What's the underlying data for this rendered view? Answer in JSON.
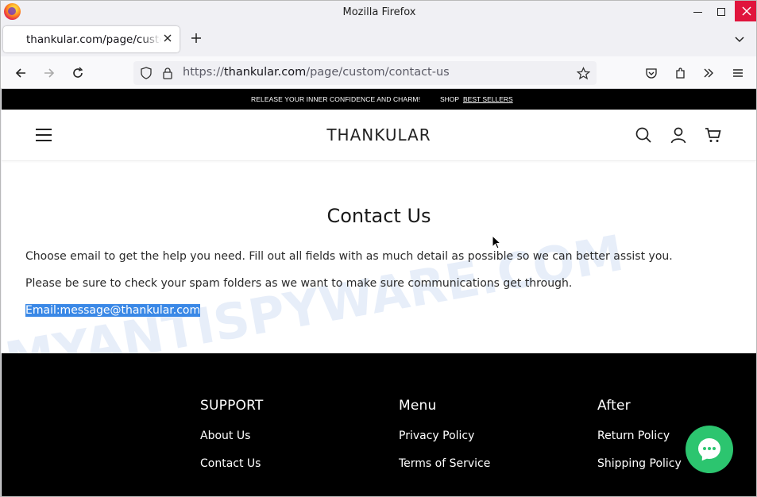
{
  "window": {
    "title": "Mozilla Firefox"
  },
  "tabs": [
    {
      "title": "thankular.com/page/custom/contact-us"
    }
  ],
  "url": {
    "prefix": "https://",
    "host": "thankular.com",
    "path": "/page/custom/contact-us"
  },
  "announcement": {
    "text": "RELEASE YOUR INNER CONFIDENCE AND CHARM!",
    "shop": "SHOP",
    "link": "BEST SELLERS"
  },
  "header": {
    "brand": "THANKULAR"
  },
  "watermark": "MYANTISPYWARE.COM",
  "content": {
    "title": "Contact Us",
    "paragraph1": "Choose email to get the help you need. Fill out all fields with as much detail as possible so we can better assist you.",
    "paragraph2": "Please be sure to check your spam folders as we want to make sure communications get through.",
    "email": "Email:message@thankular.com"
  },
  "footer": {
    "columns": [
      {
        "heading": "SUPPORT",
        "links": [
          "About Us",
          "Contact Us"
        ]
      },
      {
        "heading": "Menu",
        "links": [
          "Privacy Policy",
          "Terms of Service"
        ]
      },
      {
        "heading": "After",
        "links": [
          "Return Policy",
          "Shipping Policy"
        ]
      }
    ]
  },
  "colors": {
    "chat": "#2cc56f",
    "close": "#e0143c",
    "selection": "#3a88e6"
  }
}
